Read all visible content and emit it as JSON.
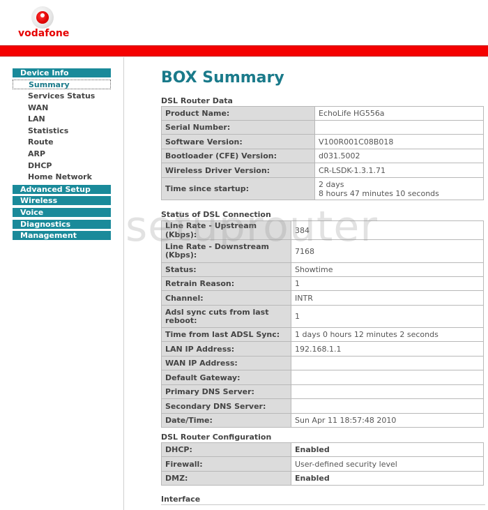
{
  "brand": {
    "name": "vodafone",
    "accent": "#e60000",
    "menu_color": "#1a8a9a"
  },
  "sidebar": {
    "categories": [
      {
        "label": "Device Info"
      },
      {
        "label": "Advanced Setup"
      },
      {
        "label": "Wireless"
      },
      {
        "label": "Voice"
      },
      {
        "label": "Diagnostics"
      },
      {
        "label": "Management"
      }
    ],
    "device_info_items": [
      {
        "label": "Summary",
        "active": true
      },
      {
        "label": "Services Status"
      },
      {
        "label": "WAN"
      },
      {
        "label": "LAN"
      },
      {
        "label": "Statistics"
      },
      {
        "label": "Route"
      },
      {
        "label": "ARP"
      },
      {
        "label": "DHCP"
      },
      {
        "label": "Home Network"
      }
    ]
  },
  "main": {
    "title": "BOX Summary",
    "router_data": {
      "title": "DSL Router Data",
      "rows": [
        {
          "label": "Product Name:",
          "value": "EchoLife  HG556a"
        },
        {
          "label": "Serial Number:",
          "value": ""
        },
        {
          "label": "Software Version:",
          "value": "V100R001C08B018"
        },
        {
          "label": "Bootloader (CFE) Version:",
          "value": "d031.5002"
        },
        {
          "label": "Wireless Driver Version:",
          "value": "CR-LSDK-1.3.1.71"
        },
        {
          "label": "Time since startup:",
          "value": "2 days",
          "value2": "8 hours 47 minutes 10 seconds"
        }
      ]
    },
    "dsl_status": {
      "title": "Status of DSL Connection",
      "rows": [
        {
          "label": "Line Rate - Upstream (Kbps):",
          "value": "384"
        },
        {
          "label": "Line Rate - Downstream (Kbps):",
          "value": "7168"
        },
        {
          "label": "Status:",
          "value": "Showtime"
        },
        {
          "label": "Retrain Reason:",
          "value": "1"
        },
        {
          "label": "Channel:",
          "value": "INTR"
        },
        {
          "label": "Adsl sync cuts from last reboot:",
          "value": "1"
        },
        {
          "label": "Time from last ADSL Sync:",
          "value": "1 days 0 hours 12 minutes 2 seconds"
        },
        {
          "label": "LAN IP Address:",
          "value": "192.168.1.1"
        },
        {
          "label": "WAN IP Address:",
          "value": ""
        },
        {
          "label": "Default Gateway:",
          "value": ""
        },
        {
          "label": "Primary DNS Server:",
          "value": ""
        },
        {
          "label": "Secondary DNS Server:",
          "value": ""
        },
        {
          "label": "Date/Time:",
          "value": "Sun Apr 11 18:57:48 2010"
        }
      ]
    },
    "router_config": {
      "title": "DSL Router Configuration",
      "rows": [
        {
          "label": "DHCP:",
          "value": "Enabled"
        },
        {
          "label": "Firewall:",
          "value": "User-defined security level"
        },
        {
          "label": "DMZ:",
          "value": "Enabled"
        }
      ]
    },
    "interface_title": "Interface"
  },
  "watermark": "setuprouter"
}
